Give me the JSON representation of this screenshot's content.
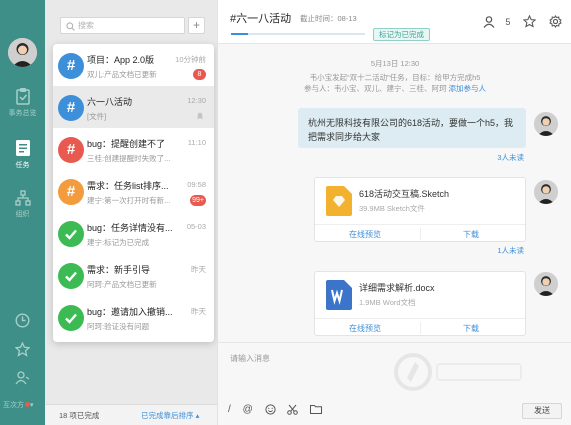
{
  "sidebar": {
    "nav": [
      {
        "label": "事务总览",
        "icon": "clipboard-icon"
      },
      {
        "label": "任务",
        "icon": "task-list-icon",
        "active": true
      },
      {
        "label": "组织",
        "icon": "org-chart-icon"
      }
    ],
    "bottom_icons": [
      "clock-icon",
      "star-icon",
      "contacts-icon"
    ],
    "user_name": "互次方"
  },
  "search": {
    "placeholder": "搜索"
  },
  "task_list": [
    {
      "title": "项目：App 2.0版",
      "subtitle": "双儿:产品文档已更新",
      "time": "10分钟前",
      "badge": "8",
      "icon": "#",
      "color": "#3d8fd9"
    },
    {
      "title": "六一八活动",
      "subtitle": "[文件]",
      "time": "12:30",
      "icon": "#",
      "color": "#3d8fd9",
      "selected": true,
      "muted": true
    },
    {
      "title": "bug：提醒创建不了",
      "subtitle": "三桂:创建提醒时失败了...",
      "time": "11:10",
      "icon": "#",
      "color": "#e85a4f"
    },
    {
      "title": "需求：任务list排序...",
      "subtitle": "建宁:第一次打开时有新...",
      "time": "09:58",
      "badge": "99+",
      "icon": "#",
      "color": "#f39c3d"
    },
    {
      "title": "bug：任务详情没有...",
      "subtitle": "建宁:标记为已完成",
      "time": "05-03",
      "icon": "check",
      "color": "#3cbb54"
    },
    {
      "title": "需求：新手引导",
      "subtitle": "阿珂:产品文档已更新",
      "time": "昨天",
      "icon": "check",
      "color": "#3cbb54"
    },
    {
      "title": "bug：邀请加入撤销...",
      "subtitle": "阿珂:验证没有问题",
      "time": "昨天",
      "icon": "check",
      "color": "#3cbb54"
    }
  ],
  "list_footer": {
    "completed": "18 项已完成",
    "sort": "已完成靠后排序"
  },
  "header": {
    "title": "#六一八活动",
    "deadline": "截止时间：08-13",
    "mark_done": "标记为已完成",
    "member_count": "5",
    "progress": 0.13
  },
  "messages": {
    "date": "5月13日 12:30",
    "system_line1": "韦小宝发起“双十二活动”任务，目标：给甲方完成h5",
    "system_line2": "参与人：韦小宝、双儿、建宁、三桂、阿珂",
    "add_member": "添加参与人",
    "text_line1": "杭州无限科技有限公司的618活动，要做一个h5，我",
    "text_line2": "把需求同步给大家",
    "text_read": "3人未读",
    "files": [
      {
        "name": "618活动交互稿.Sketch",
        "size": "39.9MB  Sketch文件",
        "preview": "在线预览",
        "download": "下载",
        "read": "1人未读",
        "icon": "sketch-file-icon"
      },
      {
        "name": "详细需求解析.docx",
        "size": "1.9MB  Word文档",
        "preview": "在线预览",
        "download": "下载",
        "icon": "word-file-icon"
      }
    ]
  },
  "composer": {
    "placeholder": "请输入消息",
    "send": "发送"
  },
  "colors": {
    "sidebar": "#3d8f87",
    "accent": "#3d8fd9",
    "red": "#e85a4f",
    "orange": "#f39c3d",
    "green": "#3cbb54"
  }
}
